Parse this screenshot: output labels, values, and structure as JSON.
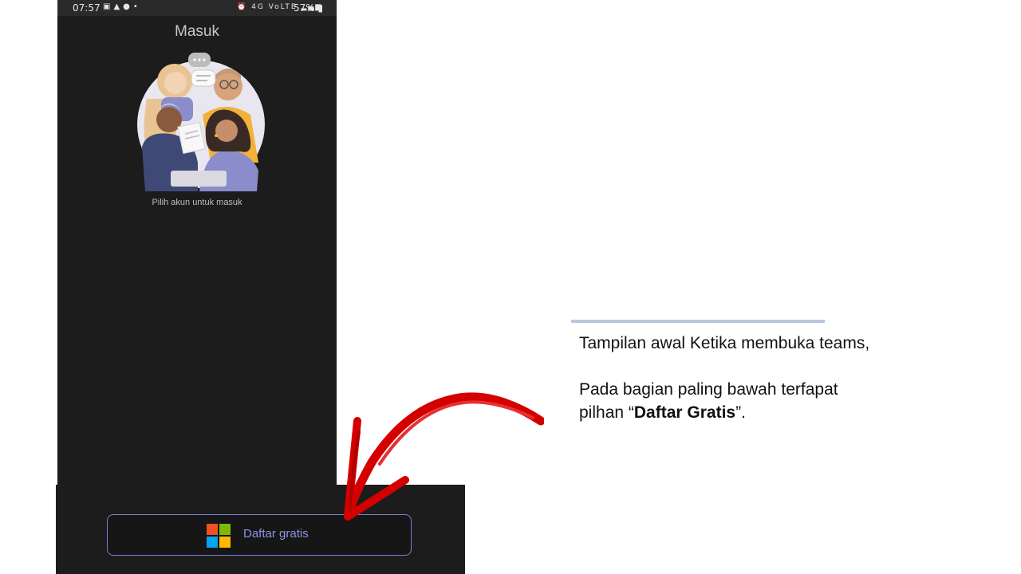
{
  "status_bar": {
    "time": "07:57",
    "left_icons": [
      "image-icon",
      "warning-icon",
      "account-icon",
      "dot-icon"
    ],
    "network_text": "4G  VoLTE",
    "battery": "57%"
  },
  "screen": {
    "title": "Masuk",
    "illustration": "people-group-illustration",
    "subtitle": "Pilih akun untuk masuk"
  },
  "signup": {
    "label": "Daftar gratis",
    "logo": "microsoft-logo",
    "accent": "#7c7fd6",
    "text_color": "#8f93e6"
  },
  "annotation": {
    "arrow_color": "#d40000"
  },
  "caption": {
    "line1": "Tampilan awal Ketika membuka teams,",
    "line2_prefix": "Pada bagian paling bawah terfapat pilhan “",
    "line2_bold": "Daftar Gratis",
    "line2_suffix": "”."
  }
}
